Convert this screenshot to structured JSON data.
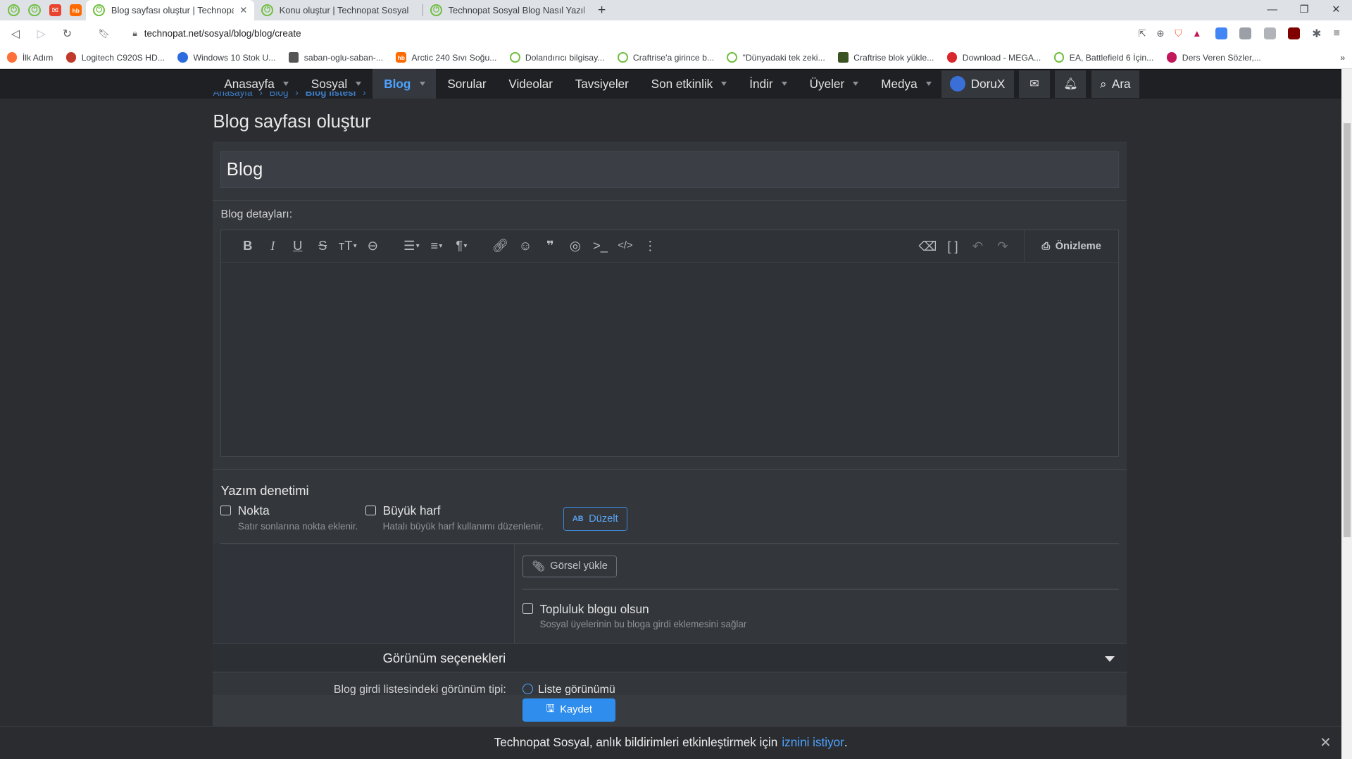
{
  "browser": {
    "tabs": [
      {
        "title": "Blog sayfası oluştur | Technopat S",
        "active": true
      },
      {
        "title": "Konu oluştur | Technopat Sosyal",
        "active": false
      },
      {
        "title": "Technopat Sosyal Blog Nasıl Yazılır? | T",
        "active": false
      }
    ],
    "url": "technopat.net/sosyal/blog/blog/create",
    "bookmarks": [
      "İlk Adım",
      "Logitech C920S HD...",
      "Windows 10 Stok U...",
      "saban-oglu-saban-...",
      "Arctic 240 Sıvı Soğu...",
      "Dolandırıcı bilgisay...",
      "Craftrise'a girince b...",
      "\"Dünyadaki tek zeki...",
      "Craftrise blok yükle...",
      "Download - MEGA...",
      "EA, Battlefield 6 İçin...",
      "Ders Veren Sözler,..."
    ],
    "bookmarks_more": "»"
  },
  "nav": {
    "items": [
      "Anasayfa",
      "Sosyal",
      "Blog",
      "Sorular",
      "Videolar",
      "Tavsiyeler",
      "Son etkinlik",
      "İndir",
      "Üyeler",
      "Medya"
    ],
    "user": "DoruX",
    "search": "Ara"
  },
  "breadcrumb": [
    "Anasayfa",
    "Blog",
    "Blog listesi"
  ],
  "page": {
    "title": "Blog sayfası oluştur",
    "blog_title_value": "Blog",
    "details_label": "Blog detayları:",
    "preview_label": "Önizleme"
  },
  "spell": {
    "heading": "Yazım denetimi",
    "opt1_label": "Nokta",
    "opt1_sub": "Satır sonlarına nokta eklenir.",
    "opt2_label": "Büyük harf",
    "opt2_sub": "Hatalı büyük harf kullanımı düzenlenir.",
    "fix_button": "Düzelt",
    "fix_icon_text": "AB"
  },
  "upload": {
    "button": "Görsel yükle",
    "community_label": "Topluluk blogu olsun",
    "community_sub": "Sosyal üyelerinin bu bloga girdi eklemesini sağlar"
  },
  "view": {
    "section_title": "Görünüm seçenekleri",
    "row_label": "Blog girdi listesindeki görünüm tipi:",
    "row_value": "Liste görünümü"
  },
  "save_button": "Kaydet",
  "notification": {
    "text": "Technopat Sosyal, anlık bildirimleri etkinleştirmek için",
    "link": "iznini istiyor",
    "end": "."
  },
  "colors": {
    "accent": "#2f8eed",
    "link": "#4da3ff",
    "panel": "#33363b",
    "nav_bg": "#1f2023"
  }
}
